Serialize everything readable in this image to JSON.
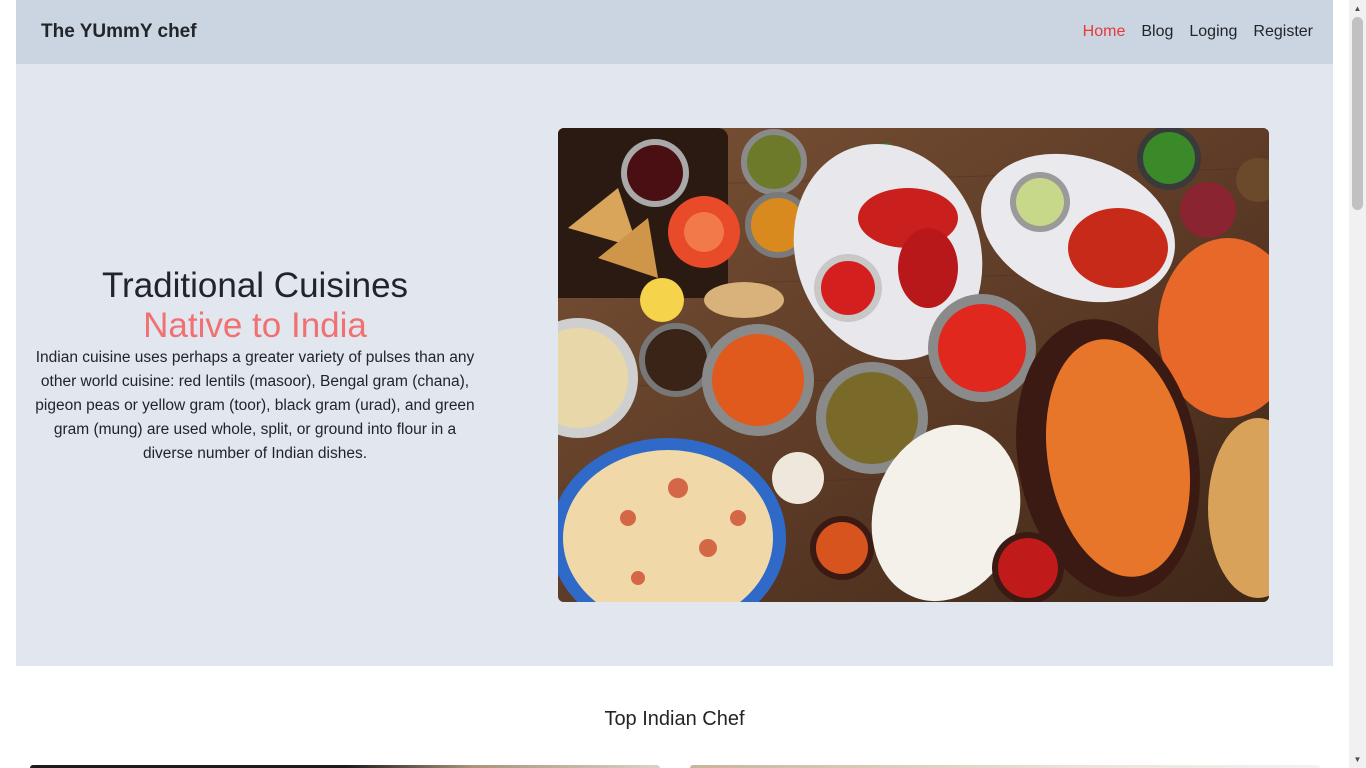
{
  "navbar": {
    "brand": "The YUmmY chef",
    "links": [
      {
        "label": "Home",
        "active": true
      },
      {
        "label": "Blog",
        "active": false
      },
      {
        "label": "Loging",
        "active": false
      },
      {
        "label": "Register",
        "active": false
      }
    ]
  },
  "hero": {
    "title": "Traditional Cuisines",
    "subtitle": "Native to India",
    "description": "Indian cuisine uses perhaps a greater variety of pulses than any other world cuisine: red lentils (masoor), Bengal gram (chana), pigeon peas or yellow gram (toor), black gram (urad), and green gram (mung) are used whole, split, or ground into flour in a diverse number of Indian dishes."
  },
  "section": {
    "title": "Top Indian Chef"
  },
  "colors": {
    "navbar_bg": "#cbd4e1",
    "hero_bg": "#e1e6ef",
    "accent_red": "#e8383d",
    "subtitle_pink": "#f07171"
  },
  "icons": {
    "scroll_up": "triangle-up-icon",
    "scroll_down": "triangle-down-icon"
  }
}
